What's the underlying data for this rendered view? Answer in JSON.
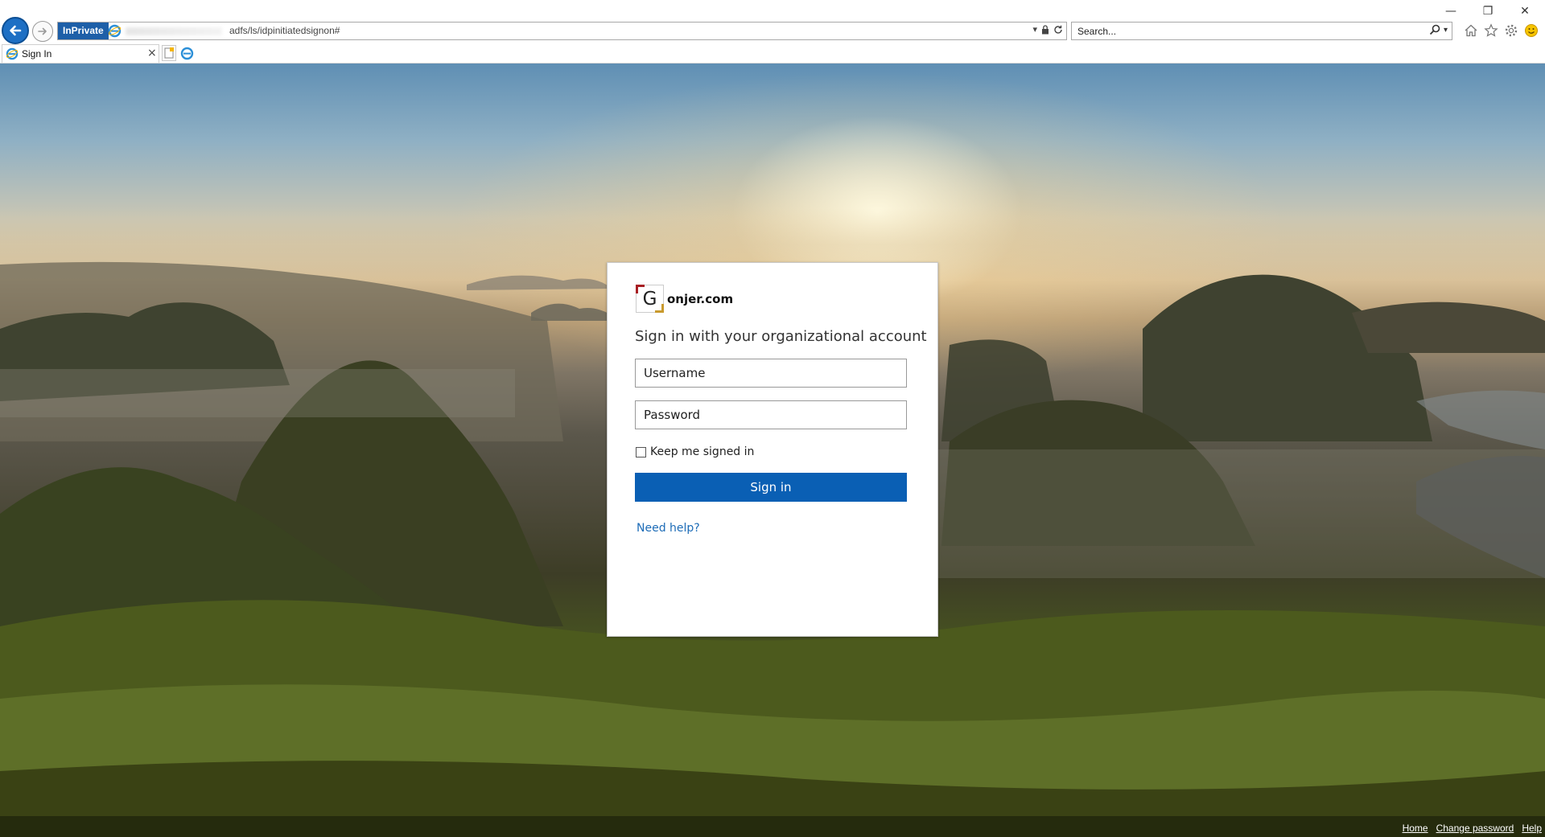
{
  "window": {
    "minimize_glyph": "—",
    "restore_glyph": "❐",
    "close_glyph": "✕"
  },
  "browser": {
    "inprivate_label": "InPrivate",
    "url": "adfs/ls/idpinitiatedsignon#",
    "search_placeholder": "Search...",
    "tab_title": "Sign In",
    "tab_close_glyph": "×",
    "icons": {
      "back": "back-arrow-icon",
      "forward": "forward-arrow-icon",
      "lock": "lock-icon",
      "refresh": "refresh-icon",
      "search": "magnifier-icon",
      "home": "home-icon",
      "favorites": "star-icon",
      "tools": "gear-icon",
      "feedback": "smiley-icon"
    }
  },
  "signin": {
    "logo_letter": "G",
    "logo_text": "onjer.com",
    "title": "Sign in with your organizational account",
    "username_placeholder": "Username",
    "password_placeholder": "Password",
    "keep_signed_in_label": "Keep me signed in",
    "keep_signed_in_checked": false,
    "button_label": "Sign in",
    "help_link": "Need help?"
  },
  "footer": {
    "links": [
      "Home",
      "Change password",
      "Help"
    ]
  },
  "colors": {
    "accent": "#0a5fb4",
    "link": "#1d6cb7",
    "inprivate_bg": "#1e5fa8"
  }
}
